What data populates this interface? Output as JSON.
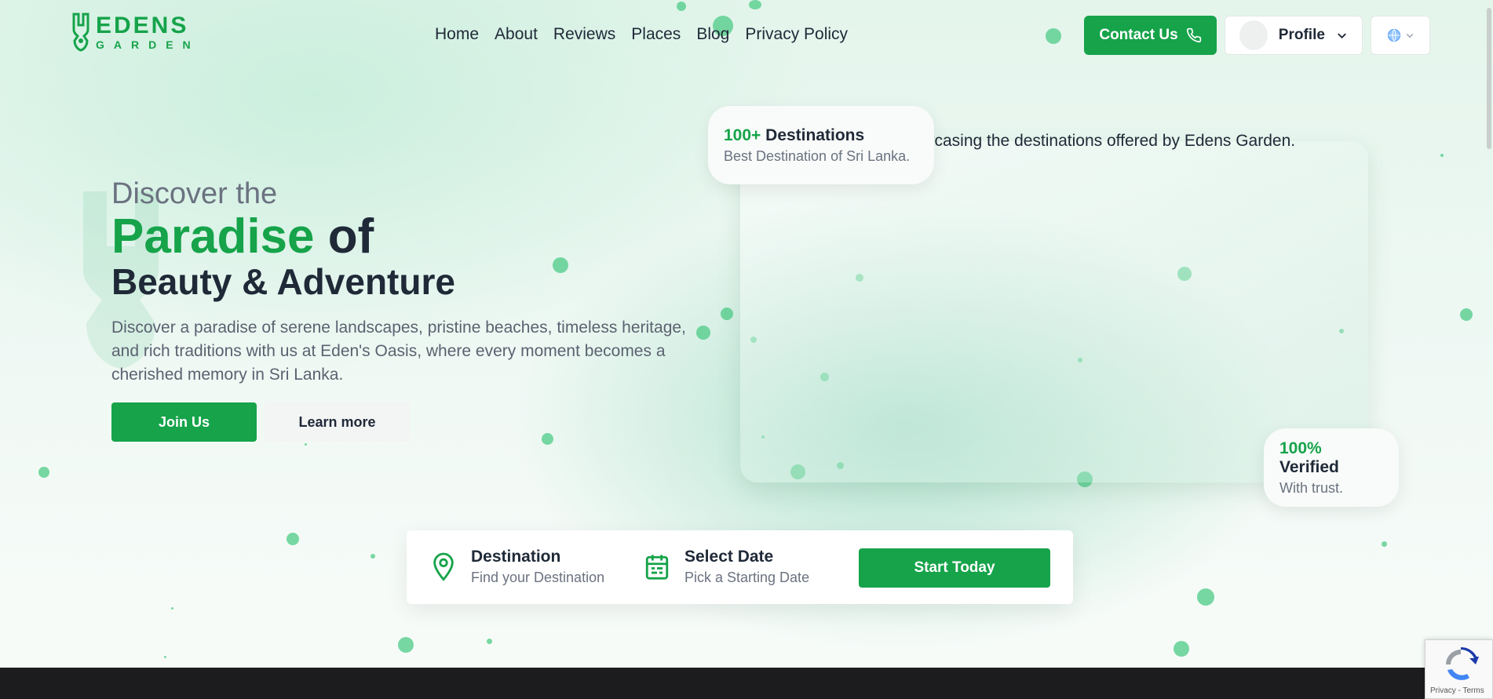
{
  "brand": {
    "name_top": "EDENS",
    "name_bottom": "GARDEN",
    "accent": "#16a34a"
  },
  "nav": {
    "items": [
      "Home",
      "About",
      "Reviews",
      "Places",
      "Blog",
      "Privacy Policy"
    ]
  },
  "header": {
    "contact_label": "Contact Us",
    "profile_label": "Profile"
  },
  "hero": {
    "pre_title": "Discover the",
    "title_green": "Paradise",
    "title_dark": "of",
    "subtitle": "Beauty & Adventure",
    "description": "Discover a paradise of serene landscapes, pristine beaches, timeless heritage, and rich traditions with us at Eden's Oasis, where every moment becomes a cherished memory in Sri Lanka.",
    "join_label": "Join Us",
    "learn_label": "Learn more"
  },
  "showcase": {
    "alt_text": "vcasing the destinations offered by Edens Garden.",
    "destinations": {
      "count": "100+",
      "label": "Destinations",
      "sub": "Best Destination of Sri Lanka."
    },
    "verified": {
      "count": "100%",
      "label": "Verified",
      "sub": "With trust."
    }
  },
  "search": {
    "destination_title": "Destination",
    "destination_sub": "Find your Destination",
    "date_title": "Select Date",
    "date_sub": "Pick a Starting Date",
    "start_label": "Start Today"
  },
  "recaptcha": {
    "links": "Privacy - Terms"
  },
  "icons": [
    "logo-icon",
    "phone-icon",
    "chevron-down-icon",
    "globe-icon",
    "map-pin-icon",
    "calendar-icon",
    "recaptcha-icon"
  ]
}
